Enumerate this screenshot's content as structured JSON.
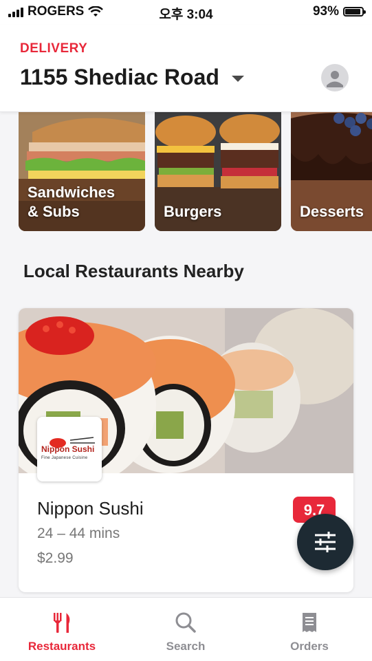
{
  "status_bar": {
    "carrier": "ROGERS",
    "time": "오후 3:04",
    "battery": "93%",
    "battery_level": 0.93
  },
  "header": {
    "mode_label": "DELIVERY",
    "address": "1155 Shediac Road",
    "icons": {
      "dropdown": "chevron-down-icon",
      "profile": "avatar-icon"
    }
  },
  "categories": [
    {
      "label_line1": "Sandwiches",
      "label_line2": "& Subs"
    },
    {
      "label_line1": "Burgers",
      "label_line2": ""
    },
    {
      "label_line1": "Desserts",
      "label_line2": ""
    }
  ],
  "section": {
    "title": "Local Restaurants Nearby"
  },
  "restaurant": {
    "name": "Nippon Sushi",
    "time_range": "24 – 44 mins",
    "delivery_fee": "$2.99",
    "rating": "9.7",
    "logo_text": "Nippon Sushi",
    "logo_tagline": "Fine Japanese Cuisine"
  },
  "filter_button": {
    "icon": "sliders-icon"
  },
  "tabbar": {
    "tabs": [
      {
        "label": "Restaurants",
        "icon": "fork-knife-icon",
        "active": true
      },
      {
        "label": "Search",
        "icon": "search-icon",
        "active": false
      },
      {
        "label": "Orders",
        "icon": "receipt-icon",
        "active": false
      }
    ]
  },
  "colors": {
    "brand_red": "#e8283a",
    "fab_dark": "#1d2a33",
    "inactive_gray": "#8e8e93"
  }
}
